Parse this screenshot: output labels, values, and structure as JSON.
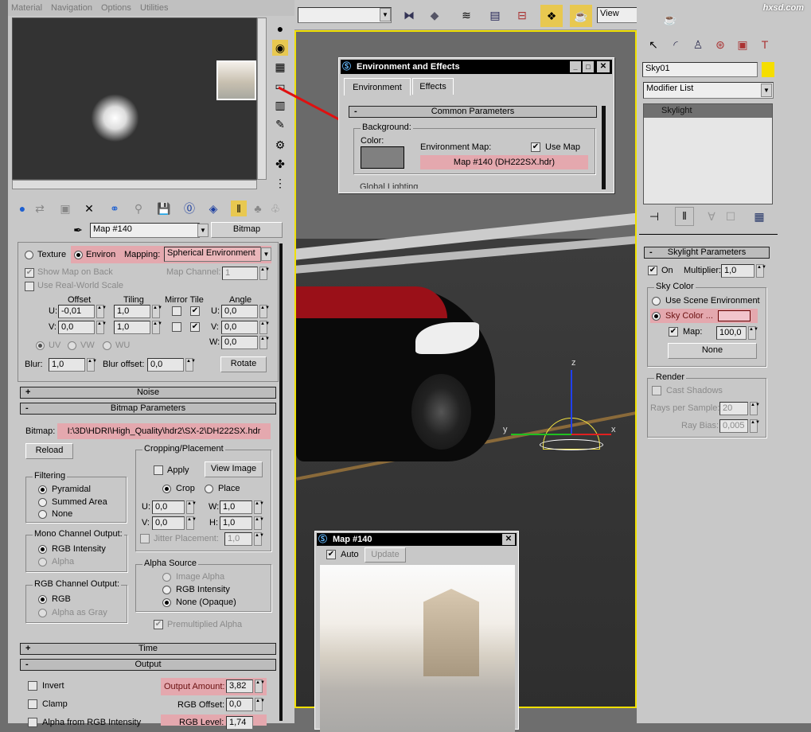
{
  "menu": [
    "Material",
    "Navigation",
    "Options",
    "Utilities"
  ],
  "mat": {
    "map_name": "Map #140",
    "map_type": "Bitmap",
    "coords": {
      "texture": "Texture",
      "environ": "Environ",
      "mapping_label": "Mapping:",
      "mapping_value": "Spherical Environment",
      "show_map_on_back": "Show Map on Back",
      "map_channel_label": "Map Channel:",
      "map_channel": "1",
      "real_world": "Use Real-World Scale",
      "offset": "Offset",
      "tiling": "Tiling",
      "mirror_tile": "Mirror Tile",
      "angle": "Angle",
      "u": "U:",
      "v": "V:",
      "w": "W:",
      "offset_u": "-0,01",
      "offset_v": "0,0",
      "tiling_u": "1,0",
      "tiling_v": "1,0",
      "angle_u": "0,0",
      "angle_v": "0,0",
      "angle_w": "0,0",
      "uv": "UV",
      "vw": "VW",
      "wu": "WU",
      "blur_label": "Blur:",
      "blur": "1,0",
      "blur_offset_label": "Blur offset:",
      "blur_offset": "0,0",
      "rotate": "Rotate"
    },
    "noise": "Noise",
    "bitmap_params": "Bitmap Parameters",
    "bitmap_label": "Bitmap:",
    "bitmap_path": "I:\\3D\\HDRI\\High_Quality\\hdr2\\SX-2\\DH222SX.hdr",
    "reload": "Reload",
    "filtering": {
      "title": "Filtering",
      "items": [
        "Pyramidal",
        "Summed Area",
        "None"
      ]
    },
    "mono": {
      "title": "Mono Channel Output:",
      "items": [
        "RGB Intensity",
        "Alpha"
      ]
    },
    "rgb": {
      "title": "RGB Channel Output:",
      "items": [
        "RGB",
        "Alpha as Gray"
      ]
    },
    "crop": {
      "title": "Cropping/Placement",
      "apply": "Apply",
      "view_image": "View Image",
      "crop": "Crop",
      "place": "Place",
      "u": "U:",
      "v": "V:",
      "w": "W:",
      "h": "H:",
      "u_val": "0,0",
      "v_val": "0,0",
      "w_val": "1,0",
      "h_val": "1,0",
      "jitter": "Jitter Placement:",
      "jitter_val": "1,0"
    },
    "alpha": {
      "title": "Alpha Source",
      "items": [
        "Image Alpha",
        "RGB Intensity",
        "None (Opaque)"
      ],
      "premult": "Premultiplied Alpha"
    },
    "time": "Time",
    "output": "Output",
    "out": {
      "invert": "Invert",
      "clamp": "Clamp",
      "alpha_from_rgb": "Alpha from RGB Intensity",
      "output_amount_label": "Output Amount:",
      "output_amount": "3,82",
      "rgb_offset_label": "RGB Offset:",
      "rgb_offset": "0,0",
      "rgb_level_label": "RGB Level:",
      "rgb_level": "1,74"
    }
  },
  "toolbar": {
    "view": "View"
  },
  "watermark": "hxsd.com",
  "env": {
    "title": "Environment and Effects",
    "tabs": [
      "Environment",
      "Effects"
    ],
    "rollout": "Common Parameters",
    "background": "Background:",
    "color": "Color:",
    "env_map": "Environment Map:",
    "use_map": "Use Map",
    "map_button": "Map #140 (DH222SX.hdr)",
    "global_lighting": "Global Lighting"
  },
  "cmd": {
    "object_name": "Sky01",
    "object_color": "#f5de00",
    "modifier_list": "Modifier List",
    "stack": [
      "Skylight"
    ],
    "rollout": "Skylight Parameters",
    "on": "On",
    "multiplier_label": "Multiplier:",
    "multiplier": "1,0",
    "sky_color": "Sky Color",
    "use_scene_env": "Use Scene Environment",
    "sky_color_opt": "Sky Color ...",
    "sky_swatch": "#f2c4cc",
    "map_label": "Map:",
    "map_amount": "100,0",
    "none": "None",
    "render": "Render",
    "cast_shadows": "Cast Shadows",
    "rays_label": "Rays per Sample:",
    "rays": "20",
    "ray_bias_label": "Ray Bias:",
    "ray_bias": "0,005"
  },
  "gizmo": {
    "x": "x",
    "y": "y",
    "z": "z"
  },
  "preview": {
    "title": "Map #140",
    "auto": "Auto",
    "update": "Update"
  }
}
